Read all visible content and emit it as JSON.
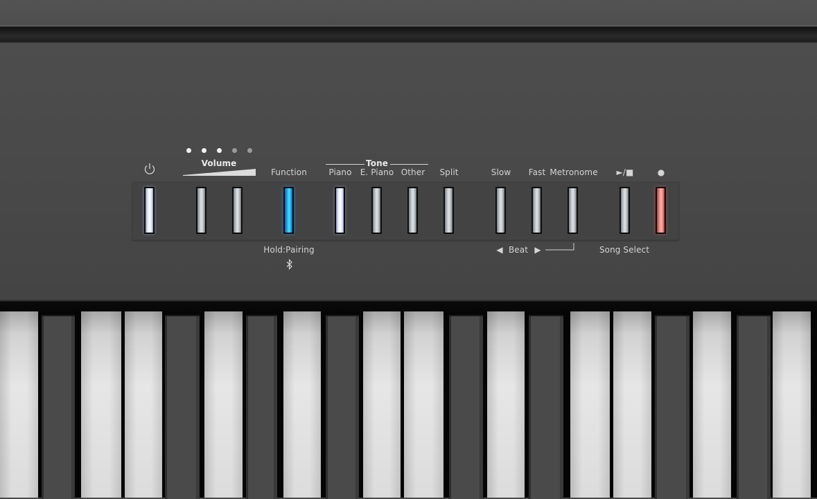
{
  "panel": {
    "power": {
      "icon": "power-icon",
      "state": "lit-white"
    },
    "volume": {
      "label": "Volume",
      "level_dots": 5,
      "level_lit": 3,
      "buttons": [
        {
          "name": "volume-down",
          "state": "off"
        },
        {
          "name": "volume-up",
          "state": "off"
        }
      ]
    },
    "function": {
      "label": "Function",
      "sublabel": "Hold:Pairing",
      "sub_icon": "bluetooth-icon",
      "state": "lit-cyan"
    },
    "tone": {
      "group_label": "Tone",
      "buttons": [
        {
          "label": "Piano",
          "state": "lit-white"
        },
        {
          "label": "E. Piano",
          "state": "off"
        },
        {
          "label": "Other",
          "state": "off"
        }
      ]
    },
    "split": {
      "label": "Split",
      "state": "off"
    },
    "slow": {
      "label": "Slow",
      "state": "off"
    },
    "fast": {
      "label": "Fast",
      "state": "off"
    },
    "metronome": {
      "label": "Metronome",
      "state": "off"
    },
    "beat": {
      "label": "Beat",
      "left_arrow": "◀",
      "right_arrow": "▶"
    },
    "play_stop": {
      "label": "►/■",
      "state": "off"
    },
    "record": {
      "label": "●",
      "state": "lit-red"
    },
    "song_select": {
      "label": "Song Select"
    }
  },
  "colors": {
    "lit_white": "#ffffff",
    "lit_cyan": "#30d8ff",
    "lit_red": "#ff9a90",
    "body": "#484848",
    "label": "#d4d4d4"
  }
}
